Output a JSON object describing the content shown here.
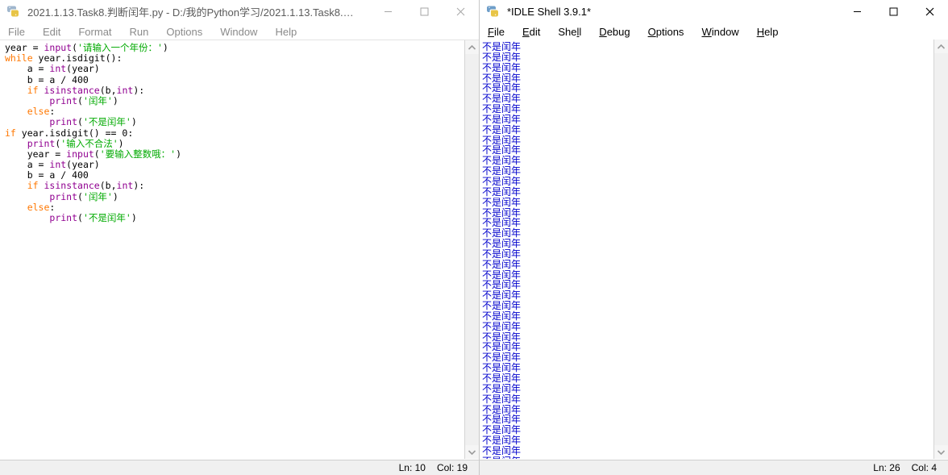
{
  "editor": {
    "window_name": "idle-editor",
    "icon": "python-idle-icon",
    "title": "2021.1.13.Task8.判断闰年.py - D:/我的Python学习/2021.1.13.Task8.判断...",
    "buttons": {
      "minimize": "minimize-icon",
      "maximize": "maximize-icon",
      "close": "close-icon"
    },
    "menu": [
      {
        "label": "File",
        "accel": ""
      },
      {
        "label": "Edit",
        "accel": ""
      },
      {
        "label": "Format",
        "accel": ""
      },
      {
        "label": "Run",
        "accel": ""
      },
      {
        "label": "Options",
        "accel": ""
      },
      {
        "label": "Window",
        "accel": ""
      },
      {
        "label": "Help",
        "accel": ""
      }
    ],
    "code_lines": [
      [
        {
          "t": "year = ",
          "c": "def"
        },
        {
          "t": "input",
          "c": "bi"
        },
        {
          "t": "(",
          "c": "def"
        },
        {
          "t": "'请输入一个年份：'",
          "c": "str"
        },
        {
          "t": ")",
          "c": "def"
        }
      ],
      [
        {
          "t": "while",
          "c": "kw"
        },
        {
          "t": " year.isdigit():",
          "c": "def"
        }
      ],
      [
        {
          "t": "    a = ",
          "c": "def"
        },
        {
          "t": "int",
          "c": "bi"
        },
        {
          "t": "(year)",
          "c": "def"
        }
      ],
      [
        {
          "t": "    b = a / 400",
          "c": "def"
        }
      ],
      [
        {
          "t": "    ",
          "c": "def"
        },
        {
          "t": "if",
          "c": "kw"
        },
        {
          "t": " ",
          "c": "def"
        },
        {
          "t": "isinstance",
          "c": "bi"
        },
        {
          "t": "(b,",
          "c": "def"
        },
        {
          "t": "int",
          "c": "bi"
        },
        {
          "t": "):",
          "c": "def"
        }
      ],
      [
        {
          "t": "        ",
          "c": "def"
        },
        {
          "t": "print",
          "c": "bi"
        },
        {
          "t": "(",
          "c": "def"
        },
        {
          "t": "'闰年'",
          "c": "str"
        },
        {
          "t": ")",
          "c": "def"
        }
      ],
      [
        {
          "t": "    ",
          "c": "def"
        },
        {
          "t": "else",
          "c": "kw"
        },
        {
          "t": ":",
          "c": "def"
        }
      ],
      [
        {
          "t": "        ",
          "c": "def"
        },
        {
          "t": "print",
          "c": "bi"
        },
        {
          "t": "(",
          "c": "def"
        },
        {
          "t": "'不是闰年'",
          "c": "str"
        },
        {
          "t": ")",
          "c": "def"
        }
      ],
      [
        {
          "t": "if",
          "c": "kw"
        },
        {
          "t": " year.isdigit() == 0:",
          "c": "def"
        }
      ],
      [
        {
          "t": "    ",
          "c": "def"
        },
        {
          "t": "print",
          "c": "bi"
        },
        {
          "t": "(",
          "c": "def"
        },
        {
          "t": "'输入不合法'",
          "c": "str"
        },
        {
          "t": ")",
          "c": "def"
        }
      ],
      [
        {
          "t": "    year = ",
          "c": "def"
        },
        {
          "t": "input",
          "c": "bi"
        },
        {
          "t": "(",
          "c": "def"
        },
        {
          "t": "'要输入整数哦：'",
          "c": "str"
        },
        {
          "t": ")",
          "c": "def"
        }
      ],
      [
        {
          "t": "    a = ",
          "c": "def"
        },
        {
          "t": "int",
          "c": "bi"
        },
        {
          "t": "(year)",
          "c": "def"
        }
      ],
      [
        {
          "t": "    b = a / 400",
          "c": "def"
        }
      ],
      [
        {
          "t": "    ",
          "c": "def"
        },
        {
          "t": "if",
          "c": "kw"
        },
        {
          "t": " ",
          "c": "def"
        },
        {
          "t": "isinstance",
          "c": "bi"
        },
        {
          "t": "(b,",
          "c": "def"
        },
        {
          "t": "int",
          "c": "bi"
        },
        {
          "t": "):",
          "c": "def"
        }
      ],
      [
        {
          "t": "        ",
          "c": "def"
        },
        {
          "t": "print",
          "c": "bi"
        },
        {
          "t": "(",
          "c": "def"
        },
        {
          "t": "'闰年'",
          "c": "str"
        },
        {
          "t": ")",
          "c": "def"
        }
      ],
      [
        {
          "t": "    ",
          "c": "def"
        },
        {
          "t": "else",
          "c": "kw"
        },
        {
          "t": ":",
          "c": "def"
        }
      ],
      [
        {
          "t": "        ",
          "c": "def"
        },
        {
          "t": "print",
          "c": "bi"
        },
        {
          "t": "(",
          "c": "def"
        },
        {
          "t": "'不是闰年'",
          "c": "str"
        },
        {
          "t": ")",
          "c": "def"
        }
      ]
    ],
    "status": {
      "line": "Ln: 10",
      "col": "Col: 19"
    },
    "scrollbar": {
      "up": "scroll-up-arrow-icon",
      "down": "scroll-down-arrow-icon"
    }
  },
  "shell": {
    "window_name": "idle-shell",
    "icon": "python-idle-icon",
    "title": "*IDLE Shell 3.9.1*",
    "buttons": {
      "minimize": "minimize-icon",
      "maximize": "maximize-icon",
      "close": "close-icon"
    },
    "menu": [
      {
        "label": "File",
        "accel": "F"
      },
      {
        "label": "Edit",
        "accel": "E"
      },
      {
        "label": "Shell",
        "accel": "l"
      },
      {
        "label": "Debug",
        "accel": "D"
      },
      {
        "label": "Options",
        "accel": "O"
      },
      {
        "label": "Window",
        "accel": "W"
      },
      {
        "label": "Help",
        "accel": "H"
      }
    ],
    "output_text": "不是闰年",
    "output_color": "#0000cc",
    "output_line_count": 41,
    "caret_visible": true,
    "status": {
      "line": "Ln: 26",
      "col": "Col: 4"
    },
    "scrollbar": {
      "up": "scroll-up-arrow-icon",
      "down": "scroll-down-arrow-icon"
    }
  }
}
